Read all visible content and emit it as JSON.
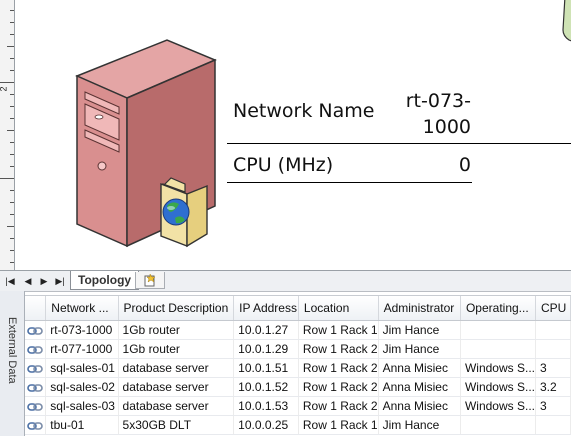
{
  "diagram": {
    "network_name_label": "Network Name",
    "network_name_value_line1": "rt-073-",
    "network_name_value_line2": "1000",
    "cpu_label": "CPU (MHz)",
    "cpu_value": "0"
  },
  "ruler": {
    "number": "2"
  },
  "tabs": {
    "first_icon": "first-page-icon",
    "prev_icon": "previous-page-icon",
    "next_icon": "next-page-icon",
    "last_icon": "last-page-icon",
    "active_label": "Topology",
    "new_tab_icon": "insert-page-icon"
  },
  "external_data": {
    "title": "External Data",
    "columns": [
      "Network ...",
      "Product Description",
      "IP Address",
      "Location",
      "Administrator",
      "Operating...",
      "CPU"
    ],
    "rows": [
      {
        "name": "rt-073-1000",
        "desc": "1Gb router",
        "ip": "10.0.1.27",
        "loc": "Row 1 Rack 1",
        "admin": "Jim Hance",
        "os": "",
        "cpu": ""
      },
      {
        "name": "rt-077-1000",
        "desc": "1Gb router",
        "ip": "10.0.1.29",
        "loc": "Row 1 Rack 2",
        "admin": "Jim Hance",
        "os": "",
        "cpu": ""
      },
      {
        "name": "sql-sales-01",
        "desc": "database server",
        "ip": "10.0.1.51",
        "loc": "Row 1 Rack 2",
        "admin": "Anna Misiec",
        "os": "Windows S...",
        "cpu": "3"
      },
      {
        "name": "sql-sales-02",
        "desc": "database server",
        "ip": "10.0.1.52",
        "loc": "Row 1 Rack 2",
        "admin": "Anna Misiec",
        "os": "Windows S...",
        "cpu": "3.2"
      },
      {
        "name": "sql-sales-03",
        "desc": "database server",
        "ip": "10.0.1.53",
        "loc": "Row 1 Rack 2",
        "admin": "Anna Misiec",
        "os": "Windows S...",
        "cpu": "3"
      },
      {
        "name": "tbu-01",
        "desc": "5x30GB DLT",
        "ip": "10.0.0.25",
        "loc": "Row 1 Rack 1",
        "admin": "Jim Hance",
        "os": "",
        "cpu": ""
      }
    ]
  },
  "colors": {
    "server_body": "#d98f8f",
    "server_dark": "#b86b6b",
    "folder": "#f2e2a6",
    "globe": "#2f6fd0",
    "right_shape": "#cfe3b5"
  }
}
